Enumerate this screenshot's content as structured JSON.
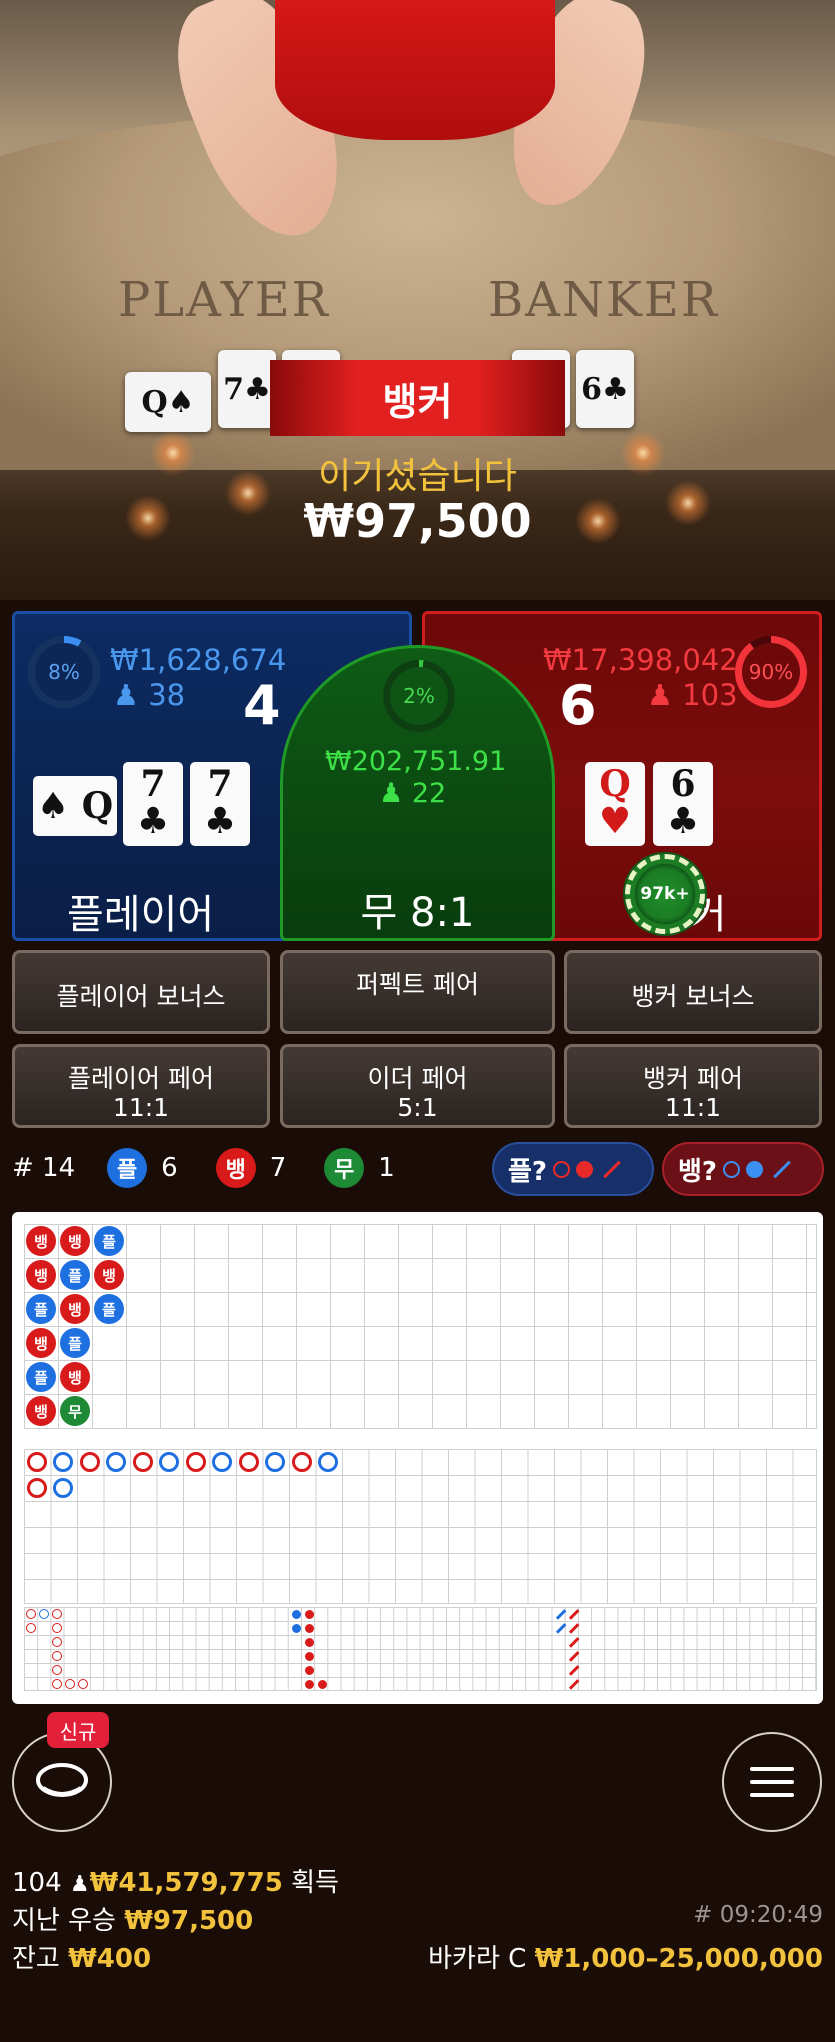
{
  "video": {
    "table_left_label": "PLAYER",
    "table_right_label": "BANKER",
    "player_cards": [
      "Q♠",
      "7♣",
      "7♣"
    ],
    "banker_cards": [
      "Q♥",
      "6♣"
    ],
    "result_label": "뱅커",
    "win_message": "이기셨습니다",
    "win_amount": "₩97,500"
  },
  "bets": {
    "player": {
      "percent": "8%",
      "percent_value": 0.08,
      "amount": "₩1,628,674",
      "count": "38",
      "score": "4",
      "cards": [
        {
          "rank": "Q",
          "suit": "♠",
          "color": "black",
          "sideways": true
        },
        {
          "rank": "7",
          "suit": "♣",
          "color": "black"
        },
        {
          "rank": "7",
          "suit": "♣",
          "color": "black"
        }
      ],
      "title": "플레이어"
    },
    "tie": {
      "percent": "2%",
      "percent_value": 0.02,
      "amount": "₩202,751.91",
      "count": "22",
      "title": "무 8:1"
    },
    "banker": {
      "percent": "90%",
      "percent_value": 0.9,
      "amount": "₩17,398,042",
      "count": "103",
      "score": "6",
      "cards": [
        {
          "rank": "Q",
          "suit": "♥",
          "color": "red"
        },
        {
          "rank": "6",
          "suit": "♣",
          "color": "black"
        }
      ],
      "title": "뱅커",
      "chip": "97k+"
    }
  },
  "side_bets": [
    {
      "label": "플레이어 보너스",
      "payout": ""
    },
    {
      "label": "퍼펙트 페어",
      "payout": ""
    },
    {
      "label": "뱅커 보너스",
      "payout": ""
    },
    {
      "label": "플레이어 페어",
      "payout": "11:1"
    },
    {
      "label": "이더 페어",
      "payout": "5:1"
    },
    {
      "label": "뱅커 페어",
      "payout": "11:1"
    }
  ],
  "stats": {
    "round": "# 14",
    "player_badge": "플",
    "player_count": "6",
    "banker_badge": "뱅",
    "banker_count": "7",
    "tie_badge": "무",
    "tie_count": "1",
    "player_predict": "플?",
    "banker_predict": "뱅?"
  },
  "bead_road": [
    [
      "뱅",
      "뱅",
      "플",
      "뱅",
      "플",
      "뱅"
    ],
    [
      "뱅",
      "플",
      "뱅",
      "플",
      "뱅",
      "무"
    ],
    [
      "플",
      "뱅",
      "플",
      "",
      "",
      ""
    ]
  ],
  "footer": {
    "new_tag": "신규",
    "players": "104",
    "total_win": "₩41,579,775",
    "total_win_suffix": "획득",
    "last_win_label": "지난 우승",
    "last_win_amount": "₩97,500",
    "round_time": "# 09:20:49",
    "balance_label": "잔고",
    "balance_amount": "₩400",
    "table_name": "바카라 C",
    "limits": "₩1,000–25,000,000"
  },
  "colors": {
    "player": "#1e6fe0",
    "banker": "#d81a1a",
    "tie": "#1e8a35",
    "gold": "#f2c23d"
  }
}
